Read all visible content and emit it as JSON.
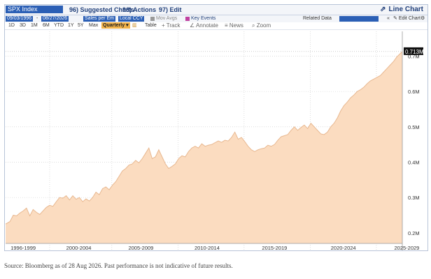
{
  "header": {
    "ticker": "SPX Index",
    "menus": [
      "96) Suggested Charts",
      "96) Actions",
      "97) Edit"
    ],
    "line_chart": "Line Chart"
  },
  "toolbar2": {
    "start_date": "09/03/1996",
    "end_date": "08/27/2026",
    "field": "Sales per Em",
    "currency": "Local CCY",
    "mov_avgs": "Mov Avgs",
    "key_events": "Key Events",
    "related_data": "Related Data",
    "edit_chart": "Edit Chart"
  },
  "toolbar3": {
    "periods": [
      "1D",
      "3D",
      "1M",
      "6M",
      "YTD",
      "1Y",
      "5Y",
      "Max"
    ],
    "frequency": "Quarterly",
    "table": "Table",
    "tools": [
      "Track",
      "Annotate",
      "News",
      "Zoom"
    ]
  },
  "colors": {
    "fill": "#fbdcc0",
    "line": "#e8b890",
    "grid": "#c8c8c8",
    "accent": "#2b5fb5",
    "frequency": "#f1b24a"
  },
  "chart_data": {
    "type": "area",
    "x_start": 1996.67,
    "x_end": 2026.66,
    "y_min": 0.17,
    "y_max": 0.77,
    "yticks": [
      "0.2M",
      "0.3M",
      "0.4M",
      "0.5M",
      "0.6M",
      "0.7M"
    ],
    "ytick_values": [
      0.2,
      0.3,
      0.4,
      0.5,
      0.6,
      0.7
    ],
    "last_value_label": "0.713M",
    "last_value": 0.713,
    "x_labels": [
      "1996-1999",
      "2000-2004",
      "2005-2009",
      "2010-2014",
      "2015-2019",
      "2020-2024",
      "2025-2029"
    ],
    "x_label_positions": [
      1998.0,
      2002.2,
      2006.9,
      2011.9,
      2017.0,
      2022.2,
      2027.0
    ],
    "x_dividers": [
      2000.0,
      2004.7,
      2009.7,
      2014.7,
      2019.7,
      2024.7
    ],
    "series": [
      {
        "x": [
          1996.67,
          1997.0,
          1997.25,
          1997.5,
          1997.75,
          1998.0,
          1998.25,
          1998.5,
          1998.75,
          1999.0,
          1999.25,
          1999.5,
          1999.75,
          2000.0,
          2000.25,
          2000.5,
          2000.75,
          2001.0,
          2001.25,
          2001.5,
          2001.75,
          2002.0,
          2002.25,
          2002.5,
          2002.75,
          2003.0,
          2003.25,
          2003.5,
          2003.75,
          2004.0,
          2004.25,
          2004.5,
          2004.75,
          2005.0,
          2005.25,
          2005.5,
          2005.75,
          2006.0,
          2006.25,
          2006.5,
          2006.75,
          2007.0,
          2007.25,
          2007.5,
          2007.75,
          2008.0,
          2008.25,
          2008.5,
          2008.75,
          2009.0,
          2009.25,
          2009.5,
          2009.75,
          2010.0,
          2010.25,
          2010.5,
          2010.75,
          2011.0,
          2011.25,
          2011.5,
          2011.75,
          2012.0,
          2012.25,
          2012.5,
          2012.75,
          2013.0,
          2013.25,
          2013.5,
          2013.75,
          2014.0,
          2014.25,
          2014.5,
          2014.75,
          2015.0,
          2015.25,
          2015.5,
          2015.75,
          2016.0,
          2016.25,
          2016.5,
          2016.75,
          2017.0,
          2017.25,
          2017.5,
          2017.75,
          2018.0,
          2018.25,
          2018.5,
          2018.75,
          2019.0,
          2019.25,
          2019.5,
          2019.75,
          2020.0,
          2020.25,
          2020.5,
          2020.75,
          2021.0,
          2021.25,
          2021.5,
          2021.75,
          2022.0,
          2022.25,
          2022.5,
          2022.75,
          2023.0,
          2023.25,
          2023.5,
          2023.75,
          2024.0,
          2024.25,
          2024.5,
          2024.75,
          2025.0,
          2025.25,
          2025.5,
          2025.75,
          2026.0,
          2026.25,
          2026.66
        ],
        "y": [
          0.225,
          0.232,
          0.25,
          0.248,
          0.256,
          0.262,
          0.27,
          0.248,
          0.266,
          0.258,
          0.252,
          0.262,
          0.272,
          0.278,
          0.275,
          0.288,
          0.3,
          0.298,
          0.305,
          0.293,
          0.305,
          0.295,
          0.3,
          0.288,
          0.296,
          0.29,
          0.3,
          0.315,
          0.308,
          0.325,
          0.33,
          0.322,
          0.335,
          0.345,
          0.36,
          0.375,
          0.382,
          0.392,
          0.395,
          0.405,
          0.398,
          0.41,
          0.425,
          0.44,
          0.41,
          0.415,
          0.435,
          0.415,
          0.395,
          0.382,
          0.388,
          0.395,
          0.41,
          0.418,
          0.415,
          0.43,
          0.44,
          0.445,
          0.44,
          0.452,
          0.445,
          0.448,
          0.45,
          0.455,
          0.46,
          0.456,
          0.462,
          0.46,
          0.47,
          0.485,
          0.465,
          0.47,
          0.458,
          0.445,
          0.435,
          0.43,
          0.435,
          0.438,
          0.44,
          0.448,
          0.445,
          0.45,
          0.462,
          0.472,
          0.475,
          0.478,
          0.49,
          0.5,
          0.49,
          0.498,
          0.505,
          0.495,
          0.51,
          0.5,
          0.49,
          0.48,
          0.478,
          0.485,
          0.5,
          0.51,
          0.525,
          0.545,
          0.56,
          0.57,
          0.582,
          0.59,
          0.6,
          0.605,
          0.612,
          0.622,
          0.63,
          0.635,
          0.64,
          0.645,
          0.655,
          0.665,
          0.675,
          0.685,
          0.698,
          0.713
        ]
      }
    ]
  },
  "footer": {
    "source": "Source: Bloomberg as of 28 Aug 2026. Past performance is not indicative of future results."
  }
}
